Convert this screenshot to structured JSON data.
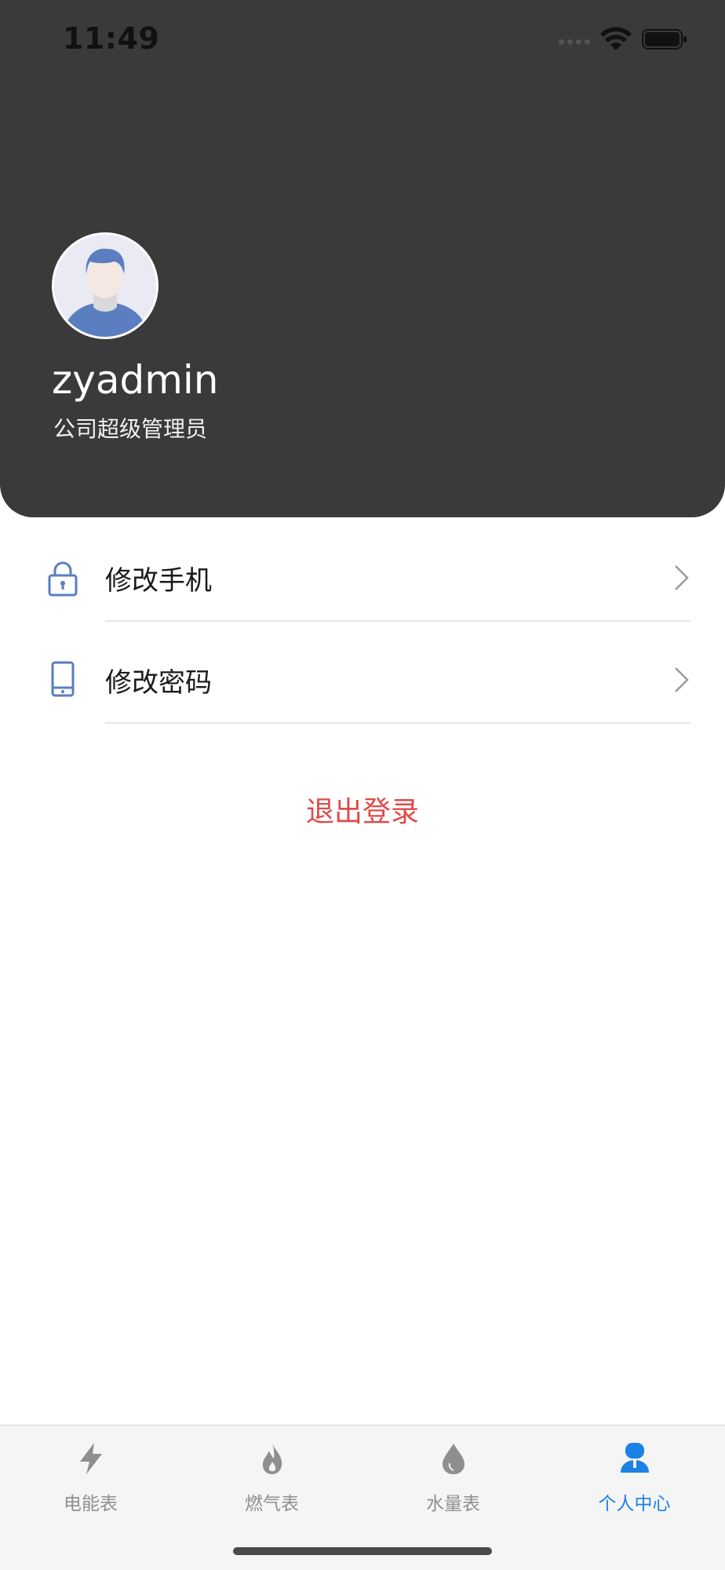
{
  "status_bar": {
    "time": "11:49"
  },
  "profile": {
    "username": "zyadmin",
    "role": "公司超级管理员"
  },
  "menu": {
    "items": [
      {
        "label": "修改手机",
        "icon": "lock-icon"
      },
      {
        "label": "修改密码",
        "icon": "phone-icon"
      }
    ],
    "logout_label": "退出登录"
  },
  "tabbar": {
    "tabs": [
      {
        "label": "电能表",
        "icon": "lightning-icon"
      },
      {
        "label": "燃气表",
        "icon": "flame-icon"
      },
      {
        "label": "水量表",
        "icon": "water-drop-icon"
      },
      {
        "label": "个人中心",
        "icon": "person-icon",
        "active": true
      }
    ]
  },
  "colors": {
    "header_bg": "#3a3a3a",
    "accent_blue": "#1b82e6",
    "icon_blue": "#5a7ec0",
    "logout_red": "#e04a48",
    "tab_inactive": "#8f8f8f"
  }
}
